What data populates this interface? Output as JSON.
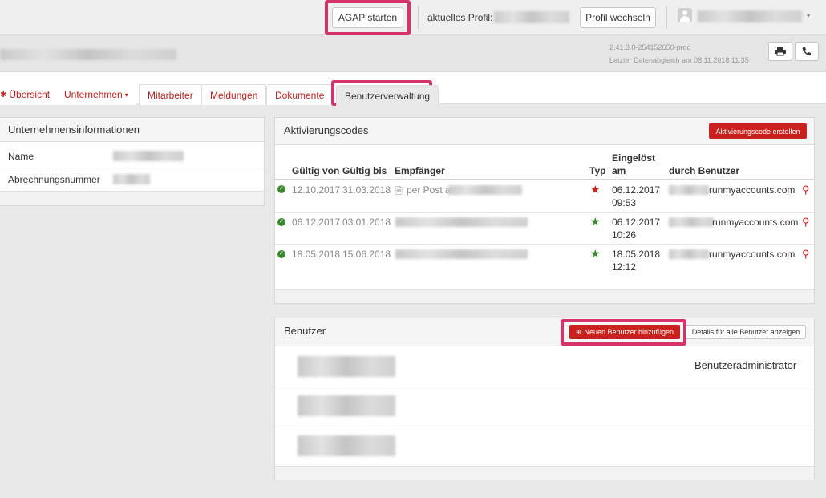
{
  "topbar": {
    "agap_button": "AGAP starten",
    "profile_label": "aktuelles Profil:",
    "switch_profile": "Profil wechseln"
  },
  "header": {
    "version": "2.41.3.0-254152650-prod",
    "last_sync": "Letzter Datenabgleich am 08.11.2018 11:35"
  },
  "nav": {
    "tabs": [
      "Übersicht",
      "Unternehmen",
      "Mitarbeiter",
      "Meldungen",
      "Dokumente",
      "Benutzerverwaltung"
    ],
    "active_tab": "Benutzerverwaltung"
  },
  "company_panel": {
    "title": "Unternehmensinformationen",
    "rows": [
      {
        "label": "Name"
      },
      {
        "label": "Abrechnungsnummer"
      }
    ]
  },
  "codes_panel": {
    "title": "Aktivierungscodes",
    "create_button": "Aktivierungscode erstellen",
    "headers": {
      "valid_from": "Gültig von",
      "valid_to": "Gültig bis",
      "recipient": "Empfänger",
      "type": "Typ",
      "redeemed_line1": "Eingelöst",
      "redeemed_line2": "am",
      "by_user": "durch Benutzer"
    },
    "rows": [
      {
        "from": "12.10.2017",
        "to": "31.03.2018",
        "recipient": "per Post a",
        "type_color": "#c9211e",
        "date": "06.12.2017",
        "time": "09:53",
        "user": "runmyaccounts.com"
      },
      {
        "from": "06.12.2017",
        "to": "03.01.2018",
        "recipient": "",
        "type_color": "#3c8a2e",
        "date": "06.12.2017",
        "time": "10:26",
        "user": "runmyaccounts.com"
      },
      {
        "from": "18.05.2018",
        "to": "15.06.2018",
        "recipient": "",
        "type_color": "#3c8a2e",
        "date": "18.05.2018",
        "time": "12:12",
        "user": "runmyaccounts.com"
      }
    ]
  },
  "users_panel": {
    "title": "Benutzer",
    "add_button": "Neuen Benutzer hinzufügen",
    "details_button": "Details für alle Benutzer anzeigen",
    "rows": [
      {
        "role": "Benutzeradministrator"
      },
      {
        "role": ""
      },
      {
        "role": ""
      }
    ]
  },
  "colors": {
    "accent": "#c9211e",
    "highlight": "#d6336c",
    "ok": "#3c8a2e"
  }
}
